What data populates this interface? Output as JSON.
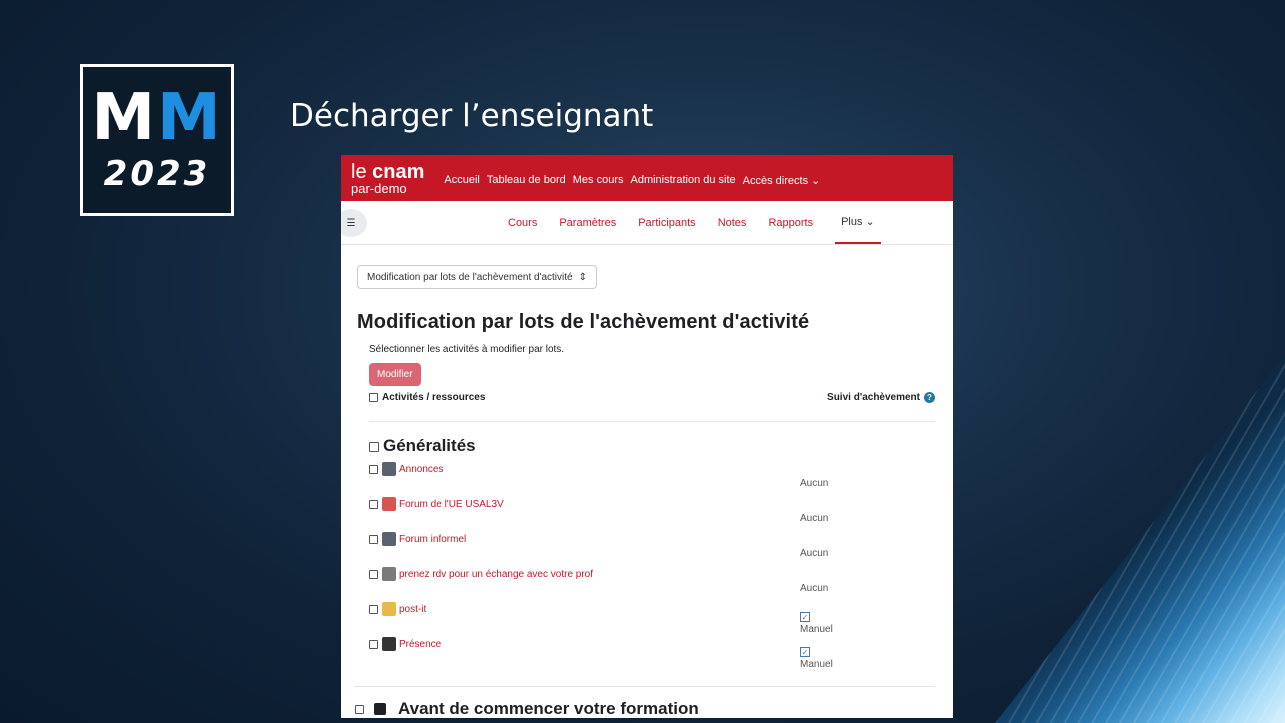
{
  "slide": {
    "logo_top": "MM",
    "logo_m1": "M",
    "logo_m2": "M",
    "logo_year": "2023",
    "title": "Décharger l’enseignant"
  },
  "app": {
    "brand_line1_prefix": "le ",
    "brand_line1_bold": "cnam",
    "brand_line2": "par-demo",
    "topnav": [
      "Accueil",
      "Tableau de bord",
      "Mes cours",
      "Administration du site",
      "Accès directs ⌄"
    ],
    "sectabs": [
      "Cours",
      "Paramètres",
      "Participants",
      "Notes",
      "Rapports",
      "Plus ⌄"
    ],
    "select_value": "Modification par lots de l'achèvement d'activité",
    "select_arrow": "⇕",
    "page_title": "Modification par lots de l'achèvement d'activité",
    "intro": "Sélectionner les activités à modifier par lots.",
    "modify_button": "Modifier",
    "col_activities": "Activités / ressources",
    "col_completion": "Suivi d'achèvement",
    "help_glyph": "?",
    "section1_title": "Généralités",
    "activities": [
      {
        "name": "Annonces",
        "status": "Aucun",
        "checked": false,
        "icon": "forum-icon",
        "color": "#5a6270"
      },
      {
        "name": "Forum de l'UE USAL3V",
        "status": "Aucun",
        "checked": false,
        "icon": "users-icon",
        "color": "#d9534f"
      },
      {
        "name": "Forum informel",
        "status": "Aucun",
        "checked": false,
        "icon": "forum-icon",
        "color": "#5a6270"
      },
      {
        "name": "prenez rdv pour un échange avec votre prof",
        "status": "Aucun",
        "checked": false,
        "icon": "calendar-icon",
        "color": "#7a7a7a"
      },
      {
        "name": "post-it",
        "status": "Manuel",
        "checked": true,
        "icon": "folder-icon",
        "color": "#e8b84a"
      },
      {
        "name": "Présence",
        "status": "Manuel",
        "checked": true,
        "icon": "attendance-icon",
        "color": "#333333"
      }
    ],
    "section2_title": "Avant de commencer votre formation"
  }
}
